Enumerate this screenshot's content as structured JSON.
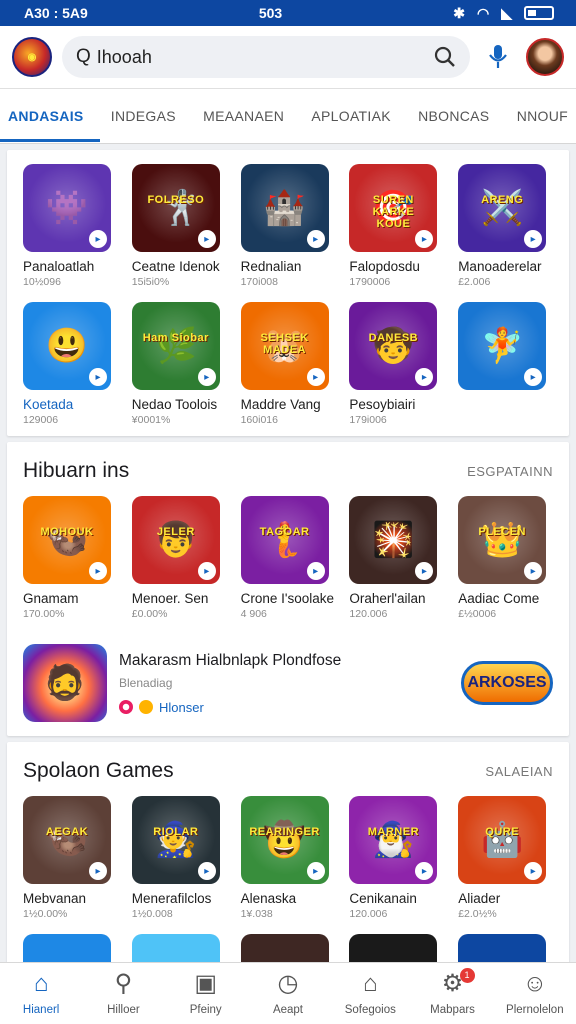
{
  "status_bar": {
    "time": "A30 : 5A9",
    "center": "503"
  },
  "search": {
    "value": "Ihooah"
  },
  "tabs": [
    "ANDASAIS",
    "INDEGAS",
    "MEAANAEN",
    "APLOATIAK",
    "NBONCAS",
    "NNOUF"
  ],
  "section1": {
    "apps": [
      {
        "name": "Panaloatlah",
        "rating": "10½096",
        "art": "👾",
        "bg": "#5e35b1",
        "sticker": ""
      },
      {
        "name": "Ceatne Idenok",
        "rating": "15i5i0%",
        "art": "🤺",
        "bg": "#4a0e0e",
        "sticker": "FOLRESO"
      },
      {
        "name": "Rednalian",
        "rating": "170i008",
        "art": "🏰",
        "bg": "#1a3a5c",
        "sticker": ""
      },
      {
        "name": "Falopdosdu",
        "rating": "1790006",
        "art": "🎯",
        "bg": "#c62828",
        "sticker": "SUREN KARKE KOUE"
      },
      {
        "name": "Manoaderelar",
        "rating": "£2.006",
        "art": "⚔️",
        "bg": "#4527a0",
        "sticker": "ARENG"
      },
      {
        "name": "Koetada",
        "rating": "129006",
        "art": "😃",
        "bg": "#1e88e5",
        "sticker": ""
      },
      {
        "name": "Nedao Toolois",
        "rating": "¥0001%",
        "art": "🌿",
        "bg": "#2e7d32",
        "sticker": "Ham Siobar"
      },
      {
        "name": "Maddre Vang",
        "rating": "160i016",
        "art": "🐹",
        "bg": "#ef6c00",
        "sticker": "SEHSEK MADEA"
      },
      {
        "name": "Pesoybiairi",
        "rating": "179i006",
        "art": "🧒",
        "bg": "#6a1b9a",
        "sticker": "DANESB"
      },
      {
        "name": "",
        "rating": "",
        "art": "🧚",
        "bg": "#1976d2",
        "sticker": ""
      }
    ]
  },
  "section2": {
    "title": "Hibuarn ins",
    "more": "ESGPATAINN",
    "apps": [
      {
        "name": "Gnamam",
        "rating": "170.00%",
        "art": "🦦",
        "bg": "#f57c00",
        "sticker": "MOHOUK"
      },
      {
        "name": "Menoer. Sen",
        "rating": "£0.00%",
        "art": "👦",
        "bg": "#c62828",
        "sticker": "JELER"
      },
      {
        "name": "Crone I'soolake",
        "rating": "4 906",
        "art": "🧜",
        "bg": "#7b1fa2",
        "sticker": "TAGOAR"
      },
      {
        "name": "Oraherl'ailan",
        "rating": "120.006",
        "art": "🎇",
        "bg": "#3e2723",
        "sticker": ""
      },
      {
        "name": "Aadiac Come",
        "rating": "£½0006",
        "art": "👑",
        "bg": "#6d4c41",
        "sticker": "PLECEN"
      }
    ],
    "featured": {
      "title": "Makarasm Hialbnlapk Plondfose",
      "subtitle": "Blenadiag",
      "developer": "Hlonser",
      "logo": "ARKOSES"
    }
  },
  "section3": {
    "title": "Spolaon Games",
    "more": "SALAEIAN",
    "apps": [
      {
        "name": "Mebvanan",
        "rating": "1½0.00%",
        "art": "🦦",
        "bg": "#5d4037",
        "sticker": "AEGAK"
      },
      {
        "name": "Menerafilclos",
        "rating": "1½0.008",
        "art": "🧙",
        "bg": "#263238",
        "sticker": "RIOLAR"
      },
      {
        "name": "Alenaska",
        "rating": "1¥.038",
        "art": "🤠",
        "bg": "#388e3c",
        "sticker": "REARINGER"
      },
      {
        "name": "Cenikanain",
        "rating": "120.006",
        "art": "🧙‍♂️",
        "bg": "#8e24aa",
        "sticker": "MARNER"
      },
      {
        "name": "Aliader",
        "rating": "£2.0½%",
        "art": "🤖",
        "bg": "#d84315",
        "sticker": "QURE"
      }
    ]
  },
  "partial_colors": [
    "#1e88e5",
    "#4fc3f7",
    "#3e2723",
    "#1a1a1a",
    "#0d47a1"
  ],
  "bottom_nav": [
    {
      "label": "Hianerl",
      "icon": "⌂",
      "active": true
    },
    {
      "label": "Hilloer",
      "icon": "⚲",
      "active": false
    },
    {
      "label": "Pfeiny",
      "icon": "▣",
      "active": false
    },
    {
      "label": "Aeapt",
      "icon": "◷",
      "active": false
    },
    {
      "label": "Sofegoios",
      "icon": "⌂",
      "active": false
    },
    {
      "label": "Mabpars",
      "icon": "⚙",
      "active": false,
      "badge": "1"
    },
    {
      "label": "Plernolelon",
      "icon": "☺",
      "active": false
    }
  ]
}
